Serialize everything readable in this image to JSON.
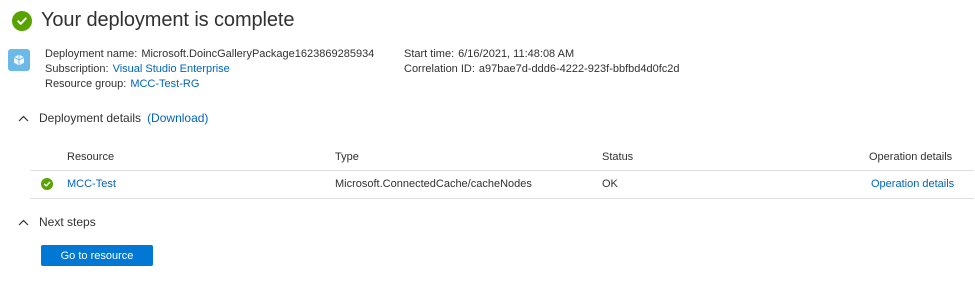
{
  "page": {
    "title": "Your deployment is complete"
  },
  "deployment": {
    "name_label": "Deployment name:",
    "name_value": "Microsoft.DoincGalleryPackage1623869285934",
    "subscription_label": "Subscription:",
    "subscription_value": "Visual Studio Enterprise",
    "resource_group_label": "Resource group:",
    "resource_group_value": "MCC-Test-RG",
    "start_time_label": "Start time:",
    "start_time_value": "6/16/2021, 11:48:08 AM",
    "correlation_label": "Correlation ID:",
    "correlation_value": "a97bae7d-ddd6-4222-923f-bbfbd4d0fc2d"
  },
  "details": {
    "header": "Deployment details",
    "download_label": "(Download)",
    "columns": {
      "resource": "Resource",
      "type": "Type",
      "status": "Status",
      "operation": "Operation details"
    },
    "rows": [
      {
        "resource": "MCC-Test",
        "type": "Microsoft.ConnectedCache/cacheNodes",
        "status": "OK",
        "operation": "Operation details"
      }
    ]
  },
  "next_steps": {
    "header": "Next steps",
    "button_label": "Go to resource"
  },
  "colors": {
    "success": "#57a300",
    "link": "#0064c0",
    "primary_button": "#0078d4",
    "deploy_icon": "#6bb9e6"
  },
  "icons": {
    "status": "success-check-icon",
    "deployment": "deployment-icon",
    "collapse": "chevron-up-icon"
  }
}
